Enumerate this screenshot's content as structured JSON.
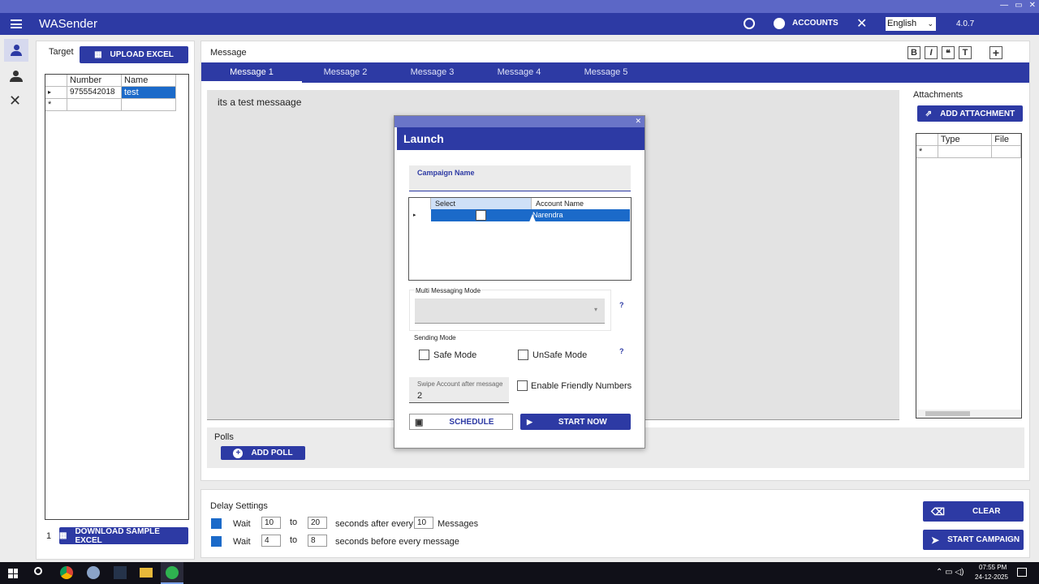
{
  "window": {
    "controls": [
      "—",
      "▭",
      "✕"
    ]
  },
  "header": {
    "title": "WASender",
    "accounts_label": "ACCOUNTS",
    "language": "English",
    "version": "4.0.7"
  },
  "target": {
    "label": "Target",
    "upload_label": "UPLOAD EXCEL",
    "columns": [
      "Number",
      "Name"
    ],
    "rows": [
      {
        "marker": "▸",
        "number": "9755542018",
        "name": "test"
      },
      {
        "marker": "*",
        "number": "",
        "name": ""
      }
    ],
    "count": "1",
    "download_label": "DOWNLOAD SAMPLE EXCEL"
  },
  "message": {
    "label": "Message",
    "tabs": [
      "Message 1",
      "Message 2",
      "Message 3",
      "Message 4",
      "Message 5"
    ],
    "active_tab": 0,
    "body": "its a test messaage",
    "toolbar": [
      "B",
      "I",
      "❝",
      "T",
      "+"
    ]
  },
  "attachments": {
    "label": "Attachments",
    "add_label": "ADD ATTACHMENT",
    "columns": [
      "Type",
      "File"
    ],
    "new_row_marker": "*"
  },
  "polls": {
    "label": "Polls",
    "add_label": "ADD POLL"
  },
  "delay": {
    "label": "Delay Settings",
    "row1": {
      "wait": "Wait",
      "from": "10",
      "to_label": "to",
      "to": "20",
      "mid": "seconds after every",
      "count": "10",
      "end": "Messages"
    },
    "row2": {
      "wait": "Wait",
      "from": "4",
      "to_label": "to",
      "to": "8",
      "mid": "seconds before every message"
    }
  },
  "actions": {
    "clear_label": "CLEAR",
    "start_label": "START CAMPAIGN"
  },
  "dialog": {
    "title": "Launch",
    "close": "✕",
    "campaign_placeholder": "Campaign Name",
    "grid_columns": [
      "Select",
      "Account Name"
    ],
    "grid_rows": [
      {
        "marker": "▸",
        "account": "Narendra",
        "selected": false
      }
    ],
    "multi_mode_label": "Multi Messaging Mode",
    "help": "?",
    "sending_mode_label": "Sending Mode",
    "safe_mode": "Safe Mode",
    "unsafe_mode": "UnSafe Mode",
    "swipe_label": "Swipe Account after message",
    "swipe_value": "2",
    "friendly_label": "Enable Friendly Numbers",
    "schedule_label": "SCHEDULE",
    "start_now_label": "START NOW"
  },
  "taskbar": {
    "time": "07:55 PM",
    "date": "24-12-2025"
  },
  "colors": {
    "primary": "#2d3aa4",
    "title_bar": "#5c67c6",
    "selection": "#1b6ac9"
  }
}
